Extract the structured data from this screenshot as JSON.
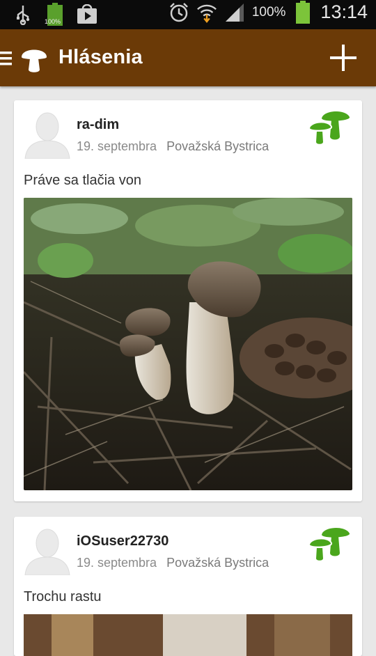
{
  "status_bar": {
    "battery_percent": "100%",
    "time": "13:14",
    "small_battery_label": "100%"
  },
  "app_bar": {
    "title": "Hlásenia"
  },
  "posts": [
    {
      "username": "ra-dim",
      "date": "19. septembra",
      "location": "Považská Bystrica",
      "text": "Práve sa tlačia von"
    },
    {
      "username": "iOSuser22730",
      "date": "19. septembra",
      "location": "Považská Bystrica",
      "text": "Trochu rastu"
    }
  ],
  "colors": {
    "app_bar": "#6b3a07",
    "badge_green": "#4aa61c",
    "background": "#e8e8e8"
  }
}
